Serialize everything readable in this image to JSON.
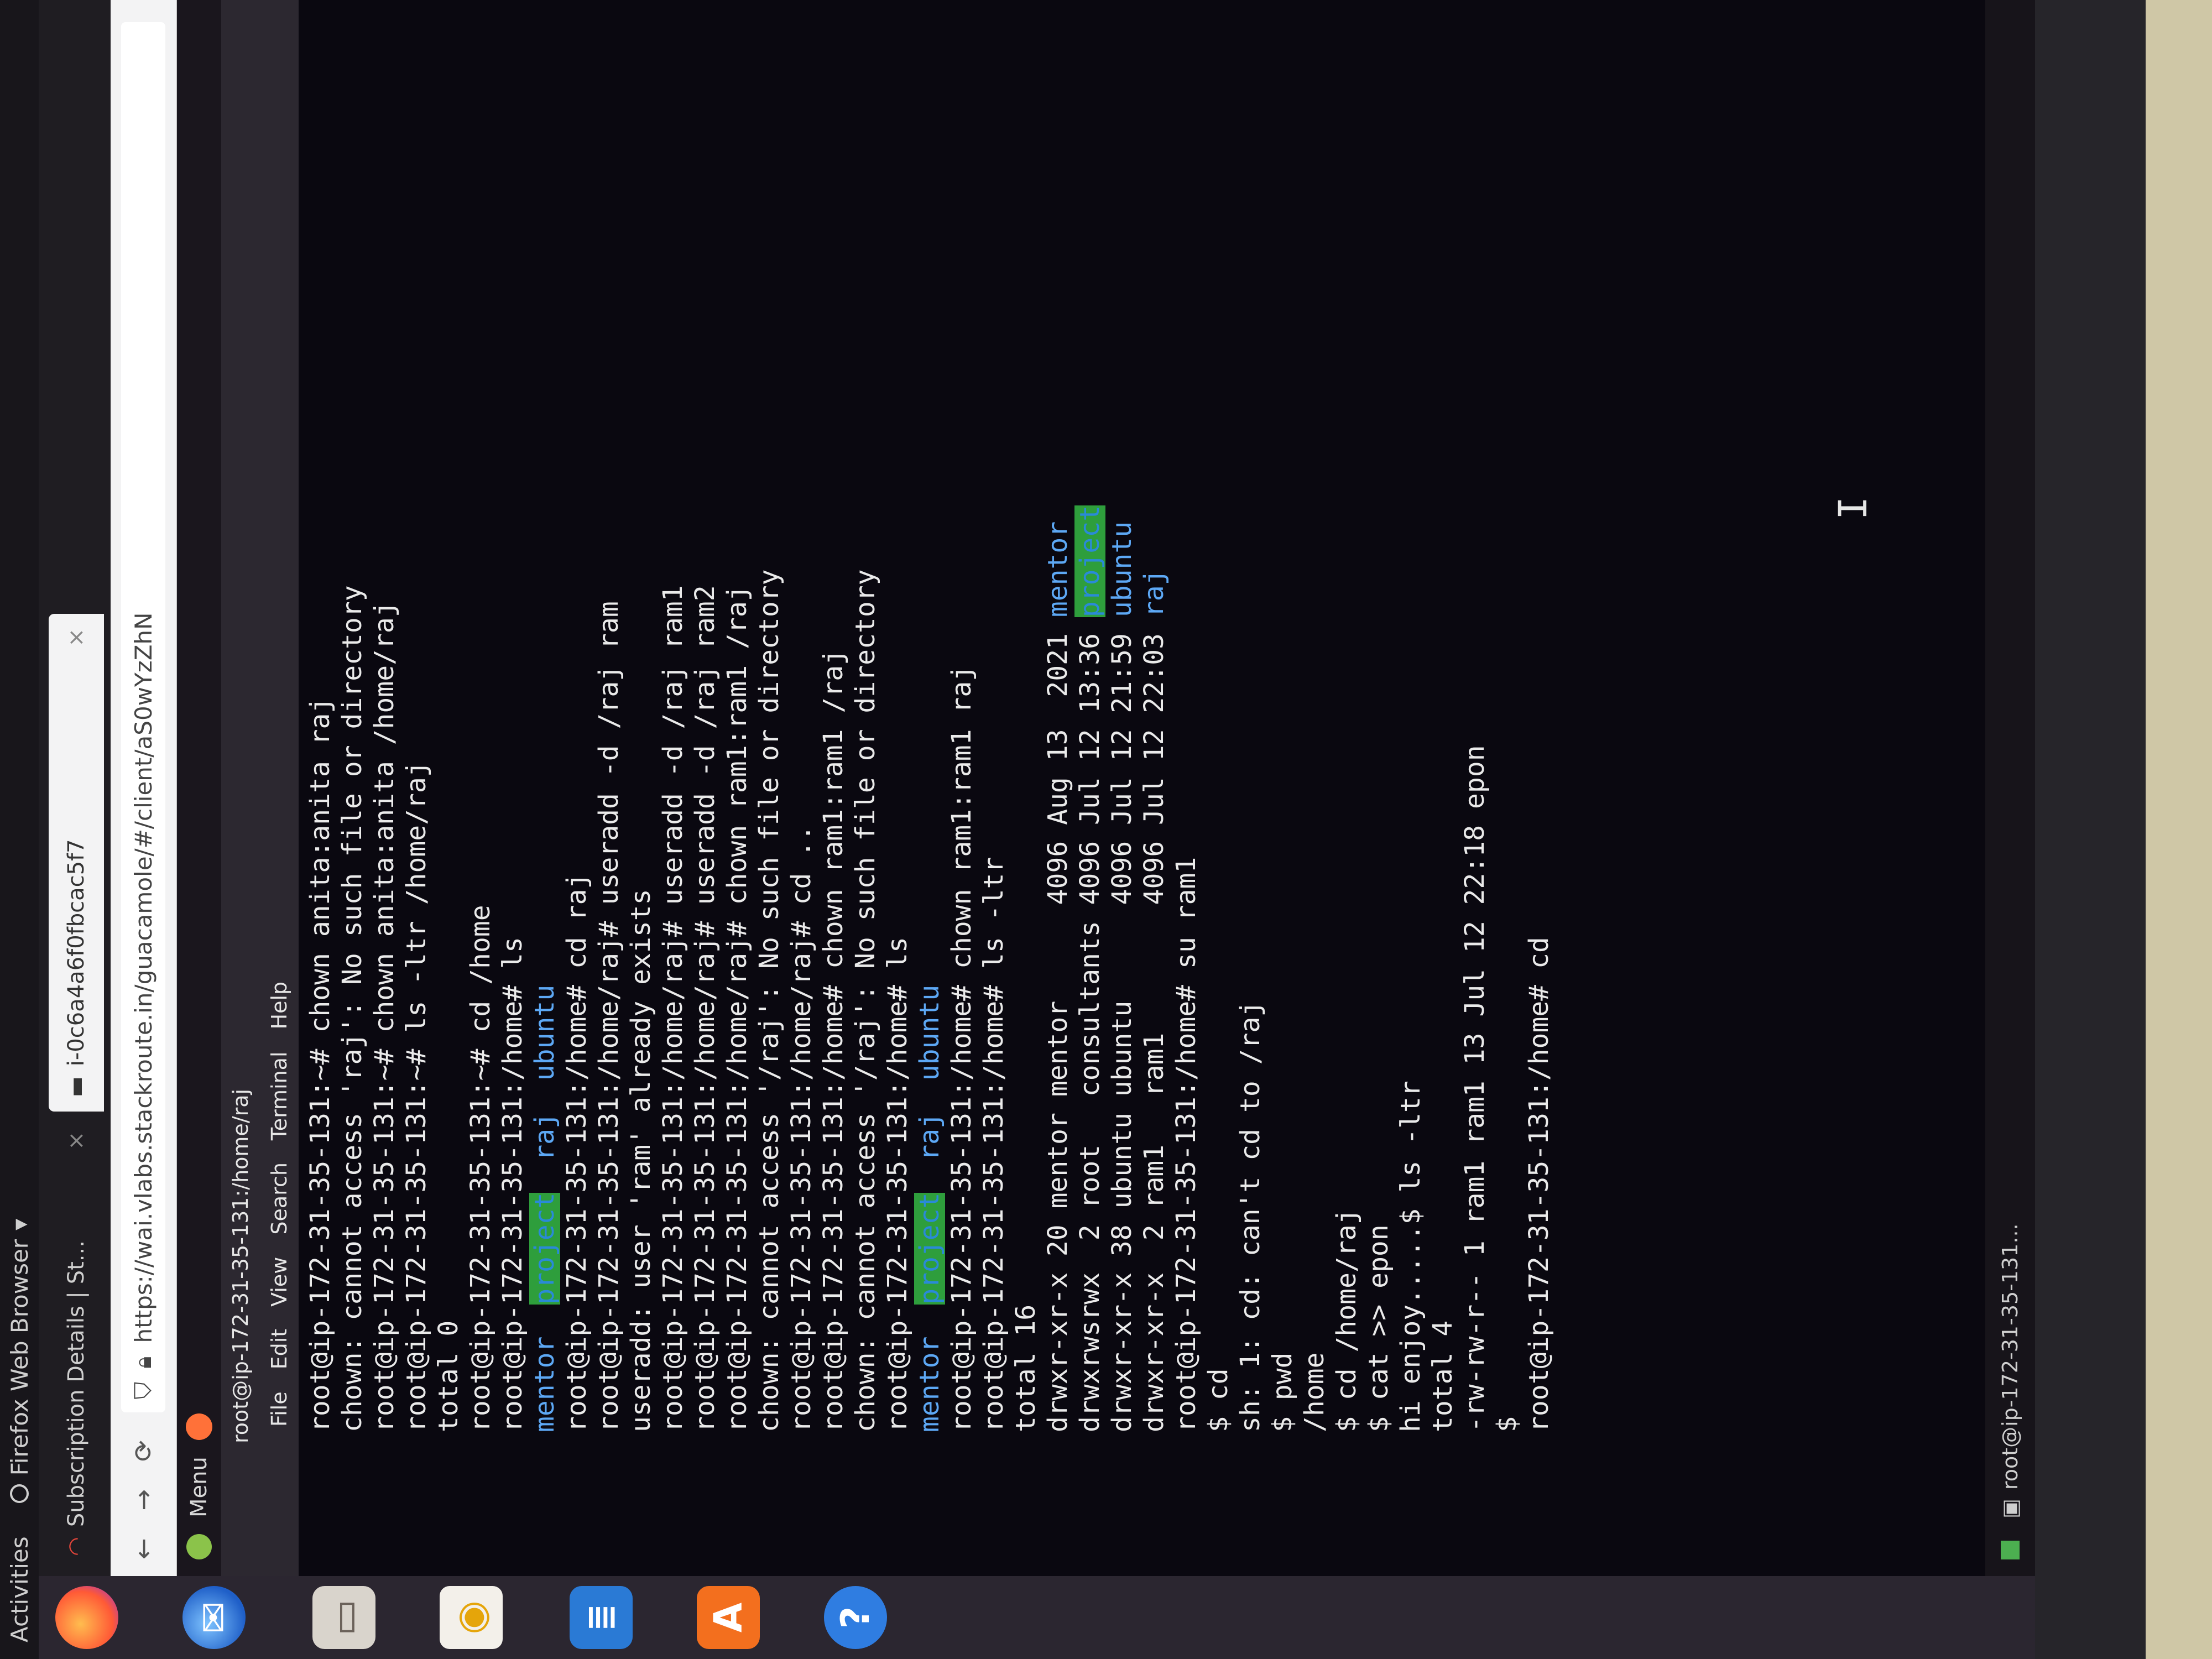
{
  "topbar": {
    "activities": "Activities",
    "app_name": "Firefox Web Browser"
  },
  "dock": {
    "icons": [
      "firefox-icon",
      "thunderbird-icon",
      "files-icon",
      "rhythmbox-icon",
      "writer-icon",
      "software-icon",
      "help-icon",
      "show-apps-icon"
    ]
  },
  "browser": {
    "tabs": [
      {
        "label": "Subscription Details | St..."
      },
      {
        "label": "i-0c6a4a6f0fbcac5f7"
      }
    ],
    "url": "https://wai.vlabs.stackroute.in/guacamole/#/client/aS0wYzZhN"
  },
  "remote": {
    "menu_label": "Menu"
  },
  "terminal": {
    "title": "root@ip-172-31-35-131:/home/raj",
    "menu": [
      "File",
      "Edit",
      "View",
      "Search",
      "Terminal",
      "Help"
    ],
    "lines": [
      [
        {
          "t": "root@ip-172-31-35-131:~# chown anita:anita raj"
        }
      ],
      [
        {
          "t": "chown: cannot access 'raj': No such file or directory"
        }
      ],
      [
        {
          "t": "root@ip-172-31-35-131:~# chown anita:anita /home/raj"
        }
      ],
      [
        {
          "t": "root@ip-172-31-35-131:~# ls -ltr /home/raj"
        }
      ],
      [
        {
          "t": "total 0"
        }
      ],
      [
        {
          "t": "root@ip-172-31-35-131:~# cd /home"
        }
      ],
      [
        {
          "t": "root@ip-172-31-35-131:/home# ls"
        }
      ],
      [
        {
          "t": "mentor",
          "c": "blue"
        },
        {
          "t": "  "
        },
        {
          "t": "project",
          "c": "green-bg"
        },
        {
          "t": "  "
        },
        {
          "t": "raj",
          "c": "blue"
        },
        {
          "t": "  "
        },
        {
          "t": "ubuntu",
          "c": "blue"
        }
      ],
      [
        {
          "t": "root@ip-172-31-35-131:/home# cd raj"
        }
      ],
      [
        {
          "t": "root@ip-172-31-35-131:/home/raj# useradd -d /raj ram"
        }
      ],
      [
        {
          "t": "useradd: user 'ram' already exists"
        }
      ],
      [
        {
          "t": "root@ip-172-31-35-131:/home/raj# useradd -d /raj ram1"
        }
      ],
      [
        {
          "t": "root@ip-172-31-35-131:/home/raj# useradd -d /raj ram2"
        }
      ],
      [
        {
          "t": "root@ip-172-31-35-131:/home/raj# chown ram1:ram1 /raj"
        }
      ],
      [
        {
          "t": "chown: cannot access '/raj': No such file or directory"
        }
      ],
      [
        {
          "t": "root@ip-172-31-35-131:/home/raj# cd .."
        }
      ],
      [
        {
          "t": "root@ip-172-31-35-131:/home# chown ram1:ram1 /raj"
        }
      ],
      [
        {
          "t": "chown: cannot access '/raj': No such file or directory"
        }
      ],
      [
        {
          "t": "root@ip-172-31-35-131:/home# ls"
        }
      ],
      [
        {
          "t": "mentor",
          "c": "blue"
        },
        {
          "t": "  "
        },
        {
          "t": "project",
          "c": "green-bg"
        },
        {
          "t": "  "
        },
        {
          "t": "raj",
          "c": "blue"
        },
        {
          "t": "  "
        },
        {
          "t": "ubuntu",
          "c": "blue"
        }
      ],
      [
        {
          "t": "root@ip-172-31-35-131:/home# chown ram1:ram1 raj"
        }
      ],
      [
        {
          "t": "root@ip-172-31-35-131:/home# ls -ltr"
        }
      ],
      [
        {
          "t": "total 16"
        }
      ],
      [
        {
          "t": "drwxr-xr-x 20 mentor mentor      4096 Aug 13  2021 "
        },
        {
          "t": "mentor",
          "c": "blue"
        }
      ],
      [
        {
          "t": "drwxrwsrwx  2 root   consultants 4096 Jul 12 13:36 "
        },
        {
          "t": "project",
          "c": "green-bg"
        }
      ],
      [
        {
          "t": "drwxr-xr-x 38 ubuntu ubuntu      4096 Jul 12 21:59 "
        },
        {
          "t": "ubuntu",
          "c": "blue"
        }
      ],
      [
        {
          "t": "drwxr-xr-x  2 ram1   ram1        4096 Jul 12 22:03 "
        },
        {
          "t": "raj",
          "c": "blue"
        }
      ],
      [
        {
          "t": "root@ip-172-31-35-131:/home# su ram1"
        }
      ],
      [
        {
          "t": "$ cd"
        }
      ],
      [
        {
          "t": "sh: 1: cd: can't cd to /raj"
        }
      ],
      [
        {
          "t": "$ pwd"
        }
      ],
      [
        {
          "t": "/home"
        }
      ],
      [
        {
          "t": "$ cd /home/raj"
        }
      ],
      [
        {
          "t": "$ cat >> epon"
        }
      ],
      [
        {
          "t": "hi enjoy.....$ ls -ltr"
        }
      ],
      [
        {
          "t": "total 4"
        }
      ],
      [
        {
          "t": "-rw-rw-r-- 1 ram1 ram1 13 Jul 12 22:18 epon"
        }
      ],
      [
        {
          "t": "$"
        }
      ],
      [
        {
          "t": "root@ip-172-31-35-131:/home# cd"
        }
      ]
    ]
  },
  "taskbar": {
    "task_label": "root@ip-172-31-35-131..."
  }
}
